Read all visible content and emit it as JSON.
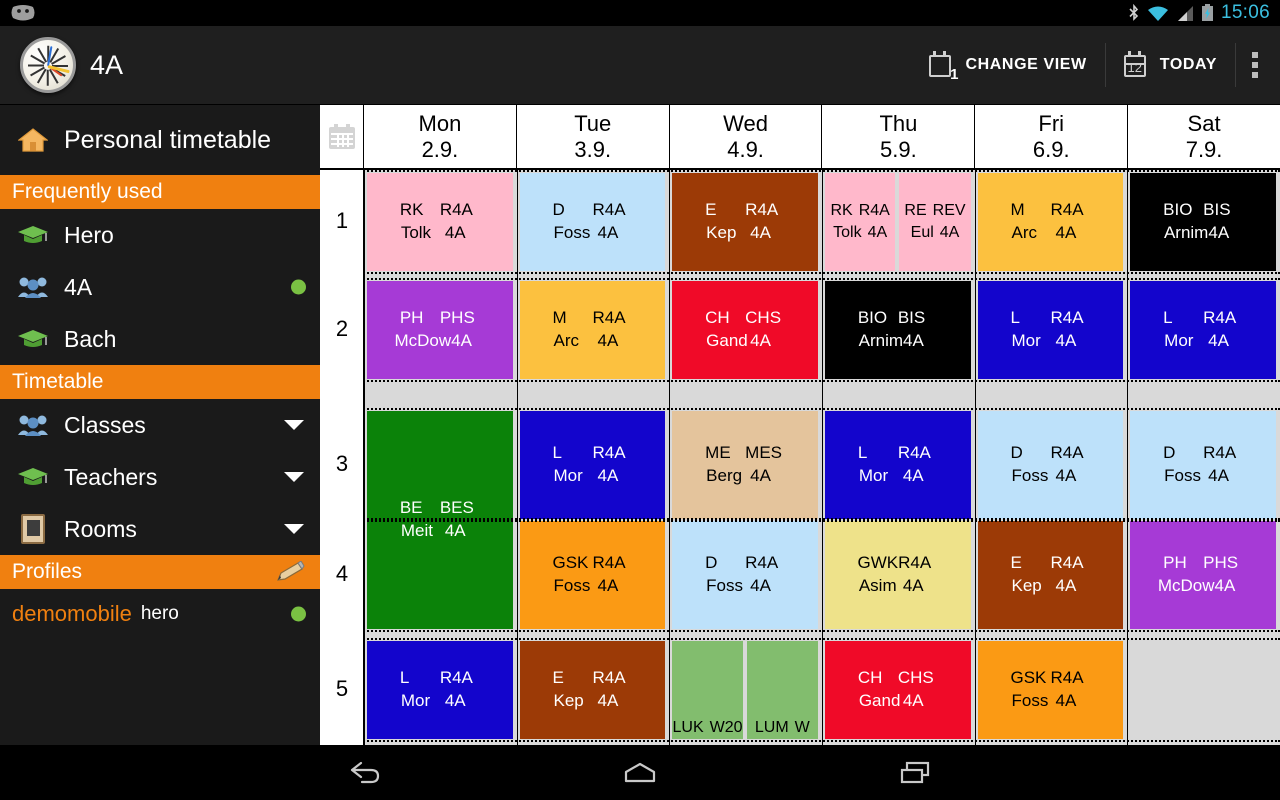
{
  "status_bar": {
    "time": "15:06",
    "icons": [
      "android-head-icon",
      "bluetooth-icon",
      "wifi-icon",
      "cell-signal-icon",
      "battery-charging-icon"
    ]
  },
  "action_bar": {
    "app_title": "4A",
    "app_icon": "clock-icon",
    "change_view_label": "CHANGE VIEW",
    "change_view_icon_badge": "1",
    "today_label": "TODAY",
    "today_icon_number": "12",
    "overflow_icon": "overflow-menu-icon"
  },
  "sidebar": {
    "personal_timetable": "Personal timetable",
    "section_frequent": "Frequently used",
    "frequent_items": [
      {
        "label": "Hero",
        "icon": "graduation-cap-icon",
        "dot": false
      },
      {
        "label": "4A",
        "icon": "class-group-icon",
        "dot": true
      },
      {
        "label": "Bach",
        "icon": "graduation-cap-icon",
        "dot": false
      }
    ],
    "section_timetable": "Timetable",
    "timetable_items": [
      {
        "label": "Classes",
        "icon": "class-group-icon"
      },
      {
        "label": "Teachers",
        "icon": "graduation-cap-icon"
      },
      {
        "label": "Rooms",
        "icon": "door-icon"
      }
    ],
    "section_profiles": "Profiles",
    "profile": {
      "name": "demomobile",
      "user": "hero",
      "dot": true
    }
  },
  "timetable": {
    "corner_icon": "calendar-grid-icon",
    "days": [
      {
        "name": "Mon",
        "date": "2.9."
      },
      {
        "name": "Tue",
        "date": "3.9."
      },
      {
        "name": "Wed",
        "date": "4.9."
      },
      {
        "name": "Thu",
        "date": "5.9."
      },
      {
        "name": "Fri",
        "date": "6.9."
      },
      {
        "name": "Sat",
        "date": "7.9."
      }
    ],
    "periods": [
      "1",
      "2",
      "3",
      "4",
      "5"
    ],
    "colors": {
      "pink": "#ffb8cb",
      "lightblue": "#bde1fa",
      "brown": "#9c3a06",
      "amber": "#fcc košice"
    },
    "lessons": [
      {
        "day": 0,
        "period": 1,
        "subject": "RK",
        "room": "R4A",
        "teacher": "Tolk",
        "klass": "4A",
        "bg": "#ffb8cb",
        "fg": "#000000",
        "split": 0
      },
      {
        "day": 1,
        "period": 1,
        "subject": "D",
        "room": "R4A",
        "teacher": "Foss",
        "klass": "4A",
        "bg": "#bde1fa",
        "fg": "#000000",
        "split": 0
      },
      {
        "day": 2,
        "period": 1,
        "subject": "E",
        "room": "R4A",
        "teacher": "Kep",
        "klass": "4A",
        "bg": "#9c3a06",
        "fg": "#ffffff",
        "split": 0
      },
      {
        "day": 3,
        "period": 1,
        "subject": "RK",
        "room": "R4A",
        "teacher": "Tolk",
        "klass": "4A",
        "bg": "#ffb8cb",
        "fg": "#000000",
        "split": 1
      },
      {
        "day": 3,
        "period": 1,
        "subject": "RE",
        "room": "REV",
        "teacher": "Eul",
        "klass": "4A",
        "bg": "#ffb8cb",
        "fg": "#000000",
        "split": 2
      },
      {
        "day": 4,
        "period": 1,
        "subject": "M",
        "room": "R4A",
        "teacher": "Arc",
        "klass": "4A",
        "bg": "#fcc13f",
        "fg": "#000000",
        "split": 0
      },
      {
        "day": 5,
        "period": 1,
        "subject": "BIO",
        "room": "BIS",
        "teacher": "Arnim",
        "klass": "4A",
        "bg": "#000000",
        "fg": "#ffffff",
        "split": 0
      },
      {
        "day": 0,
        "period": 2,
        "subject": "PH",
        "room": "PHS",
        "teacher": "McDow",
        "klass": "4A",
        "bg": "#a63ad6",
        "fg": "#ffffff",
        "split": 0
      },
      {
        "day": 1,
        "period": 2,
        "subject": "M",
        "room": "R4A",
        "teacher": "Arc",
        "klass": "4A",
        "bg": "#fcc13f",
        "fg": "#000000",
        "split": 0
      },
      {
        "day": 2,
        "period": 2,
        "subject": "CH",
        "room": "CHS",
        "teacher": "Gand",
        "klass": "4A",
        "bg": "#f00a28",
        "fg": "#ffffff",
        "split": 0
      },
      {
        "day": 3,
        "period": 2,
        "subject": "BIO",
        "room": "BIS",
        "teacher": "Arnim",
        "klass": "4A",
        "bg": "#000000",
        "fg": "#ffffff",
        "split": 0
      },
      {
        "day": 4,
        "period": 2,
        "subject": "L",
        "room": "R4A",
        "teacher": "Mor",
        "klass": "4A",
        "bg": "#1305cc",
        "fg": "#ffffff",
        "split": 0
      },
      {
        "day": 5,
        "period": 2,
        "subject": "L",
        "room": "R4A",
        "teacher": "Mor",
        "klass": "4A",
        "bg": "#1305cc",
        "fg": "#ffffff",
        "split": 0
      },
      {
        "day": 0,
        "period": 3,
        "subject": "BE",
        "room": "BES",
        "teacher": "Meit",
        "klass": "4A",
        "bg": "#0b8209",
        "fg": "#ffffff",
        "split": 0,
        "span": 2
      },
      {
        "day": 1,
        "period": 3,
        "subject": "L",
        "room": "R4A",
        "teacher": "Mor",
        "klass": "4A",
        "bg": "#1305cc",
        "fg": "#ffffff",
        "split": 0
      },
      {
        "day": 2,
        "period": 3,
        "subject": "ME",
        "room": "MES",
        "teacher": "Berg",
        "klass": "4A",
        "bg": "#e4c49c",
        "fg": "#000000",
        "split": 0
      },
      {
        "day": 3,
        "period": 3,
        "subject": "L",
        "room": "R4A",
        "teacher": "Mor",
        "klass": "4A",
        "bg": "#1305cc",
        "fg": "#ffffff",
        "split": 0
      },
      {
        "day": 4,
        "period": 3,
        "subject": "D",
        "room": "R4A",
        "teacher": "Foss",
        "klass": "4A",
        "bg": "#bde1fa",
        "fg": "#000000",
        "split": 0
      },
      {
        "day": 5,
        "period": 3,
        "subject": "D",
        "room": "R4A",
        "teacher": "Foss",
        "klass": "4A",
        "bg": "#bde1fa",
        "fg": "#000000",
        "split": 0
      },
      {
        "day": 1,
        "period": 4,
        "subject": "GSK",
        "room": "R4A",
        "teacher": "Foss",
        "klass": "4A",
        "bg": "#fb9a14",
        "fg": "#000000",
        "split": 0
      },
      {
        "day": 2,
        "period": 4,
        "subject": "D",
        "room": "R4A",
        "teacher": "Foss",
        "klass": "4A",
        "bg": "#bde1fa",
        "fg": "#000000",
        "split": 0
      },
      {
        "day": 3,
        "period": 4,
        "subject": "GWK",
        "room": "R4A",
        "teacher": "Asim",
        "klass": "4A",
        "bg": "#eee28a",
        "fg": "#000000",
        "split": 0
      },
      {
        "day": 4,
        "period": 4,
        "subject": "E",
        "room": "R4A",
        "teacher": "Kep",
        "klass": "4A",
        "bg": "#9c3a06",
        "fg": "#ffffff",
        "split": 0
      },
      {
        "day": 5,
        "period": 4,
        "subject": "PH",
        "room": "PHS",
        "teacher": "McDow",
        "klass": "4A",
        "bg": "#a63ad6",
        "fg": "#ffffff",
        "split": 0
      },
      {
        "day": 0,
        "period": 5,
        "subject": "L",
        "room": "R4A",
        "teacher": "Mor",
        "klass": "4A",
        "bg": "#1305cc",
        "fg": "#ffffff",
        "split": 0
      },
      {
        "day": 1,
        "period": 5,
        "subject": "E",
        "room": "R4A",
        "teacher": "Kep",
        "klass": "4A",
        "bg": "#9c3a06",
        "fg": "#ffffff",
        "split": 0
      },
      {
        "day": 2,
        "period": 5,
        "subject": "LUK",
        "room": "W20",
        "teacher": "",
        "klass": "",
        "bg": "#82bd6e",
        "fg": "#000000",
        "split": 1,
        "bottom_text": true
      },
      {
        "day": 2,
        "period": 5,
        "subject": "LUM",
        "room": "W",
        "teacher": "",
        "klass": "",
        "bg": "#82bd6e",
        "fg": "#000000",
        "split": 2,
        "bottom_text": true
      },
      {
        "day": 3,
        "period": 5,
        "subject": "CH",
        "room": "CHS",
        "teacher": "Gand",
        "klass": "4A",
        "bg": "#f00a28",
        "fg": "#ffffff",
        "split": 0
      },
      {
        "day": 4,
        "period": 5,
        "subject": "GSK",
        "room": "R4A",
        "teacher": "Foss",
        "klass": "4A",
        "bg": "#fb9a14",
        "fg": "#000000",
        "split": 0
      }
    ]
  },
  "nav_bar": {
    "back": "back-icon",
    "home": "home-icon",
    "recents": "recents-icon"
  }
}
